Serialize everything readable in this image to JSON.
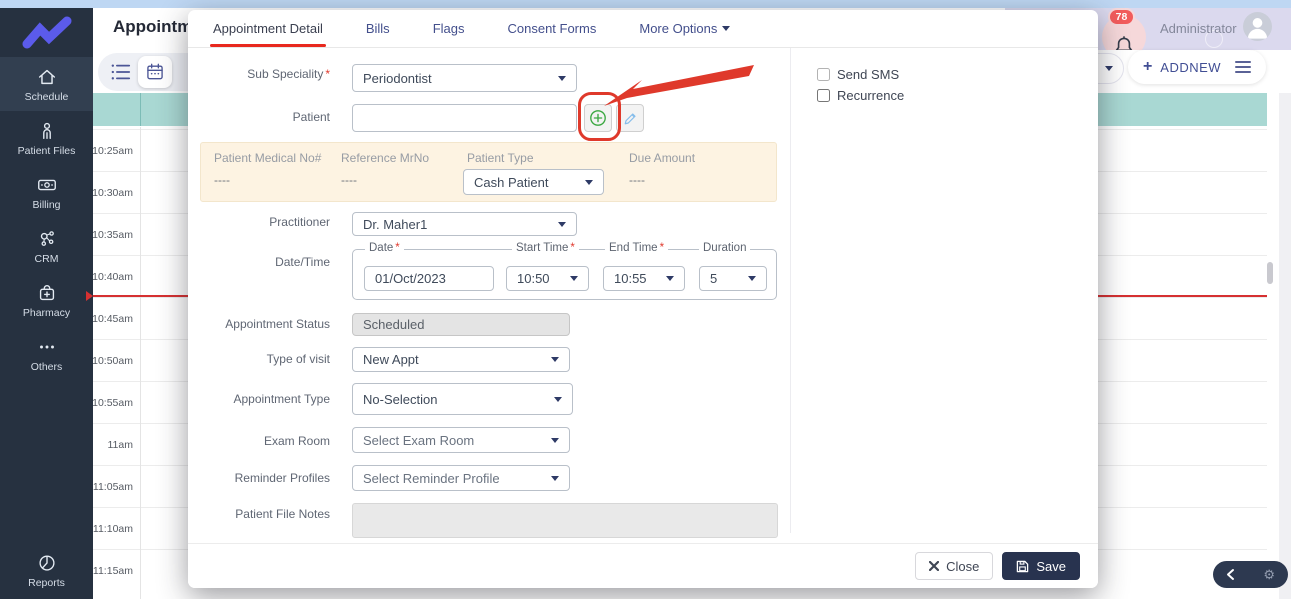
{
  "colors": {
    "sidebar_bg": "#263140",
    "sidebar_active": "#323f50",
    "accent_blue": "#5b5beb",
    "teal": "#a9d8d3",
    "teal_divider": "#7cbcb6",
    "lavender": "#dbd9ee",
    "red_annotation": "#df392b",
    "red_line": "#d63031",
    "tab_red": "#e8281e",
    "navy_text": "#434f8c",
    "dark_navy_btn": "#28334f",
    "green_plus": "#3ba842",
    "pencil_blue": "#85bdeb",
    "cream": "#fdf3e2",
    "badge_red": "#f25c5c"
  },
  "icons": {
    "gear": "⚙"
  },
  "topbar": {
    "title": "Appointme",
    "notification_count": "78",
    "user_name": "Administrator"
  },
  "sidebar": {
    "items": [
      {
        "label": "Schedule",
        "icon": "home-icon",
        "active": true
      },
      {
        "label": "Patient Files",
        "icon": "person-icon"
      },
      {
        "label": "Billing",
        "icon": "banknote-icon"
      },
      {
        "label": "CRM",
        "icon": "network-icon"
      },
      {
        "label": "Pharmacy",
        "icon": "pharmacy-bag-icon"
      },
      {
        "label": "Others",
        "icon": "ellipsis-icon"
      }
    ],
    "bottom_item": {
      "label": "Reports",
      "icon": "pie-chart-icon"
    }
  },
  "toolbar": {
    "addnew_plus": "+",
    "addnew_label": "ADDNEW"
  },
  "schedule": {
    "times": [
      "10:25am",
      "10:30am",
      "10:35am",
      "10:40am",
      "10:45am",
      "10:50am",
      "10:55am",
      "11am",
      "11:05am",
      "11:10am",
      "11:15am"
    ]
  },
  "modal": {
    "tabs": [
      {
        "label": "Appointment Detail",
        "active": true
      },
      {
        "label": "Bills"
      },
      {
        "label": "Flags"
      },
      {
        "label": "Consent Forms"
      },
      {
        "label": "More Options",
        "has_caret": true
      }
    ],
    "form": {
      "sub_speciality": {
        "label": "Sub Speciality",
        "req": "*",
        "value": "Periodontist"
      },
      "patient": {
        "label": "Patient",
        "value": ""
      },
      "info_bar": {
        "medical_no": {
          "label": "Patient Medical No#",
          "value": "----"
        },
        "reference_mrno": {
          "label": "Reference MrNo",
          "value": "----"
        },
        "patient_type": {
          "label": "Patient Type",
          "value": "Cash Patient"
        },
        "due_amount": {
          "label": "Due Amount",
          "value": "----"
        }
      },
      "practitioner": {
        "label": "Practitioner",
        "value": "Dr. Maher1"
      },
      "datetime": {
        "label": "Date/Time",
        "date": {
          "label": "Date",
          "req": "*",
          "value": "01/Oct/2023"
        },
        "start_time": {
          "label": "Start Time",
          "req": "*",
          "value": "10:50"
        },
        "end_time": {
          "label": "End Time",
          "req": "*",
          "value": "10:55"
        },
        "duration": {
          "label": "Duration",
          "value": "5"
        }
      },
      "status": {
        "label": "Appointment Status",
        "value": "Scheduled"
      },
      "visit_type": {
        "label": "Type of visit",
        "value": "New Appt"
      },
      "appointment_type": {
        "label": "Appointment Type",
        "value": "No-Selection"
      },
      "exam_room": {
        "label": "Exam Room",
        "value": "Select Exam Room"
      },
      "reminder_profiles": {
        "label": "Reminder Profiles",
        "value": "Select Reminder Profile"
      },
      "notes": {
        "label": "Patient File Notes",
        "value": ""
      }
    },
    "options": {
      "send_sms": "Send SMS",
      "recurrence": "Recurrence"
    },
    "footer": {
      "close_label": "Close",
      "save_label": "Save"
    }
  }
}
